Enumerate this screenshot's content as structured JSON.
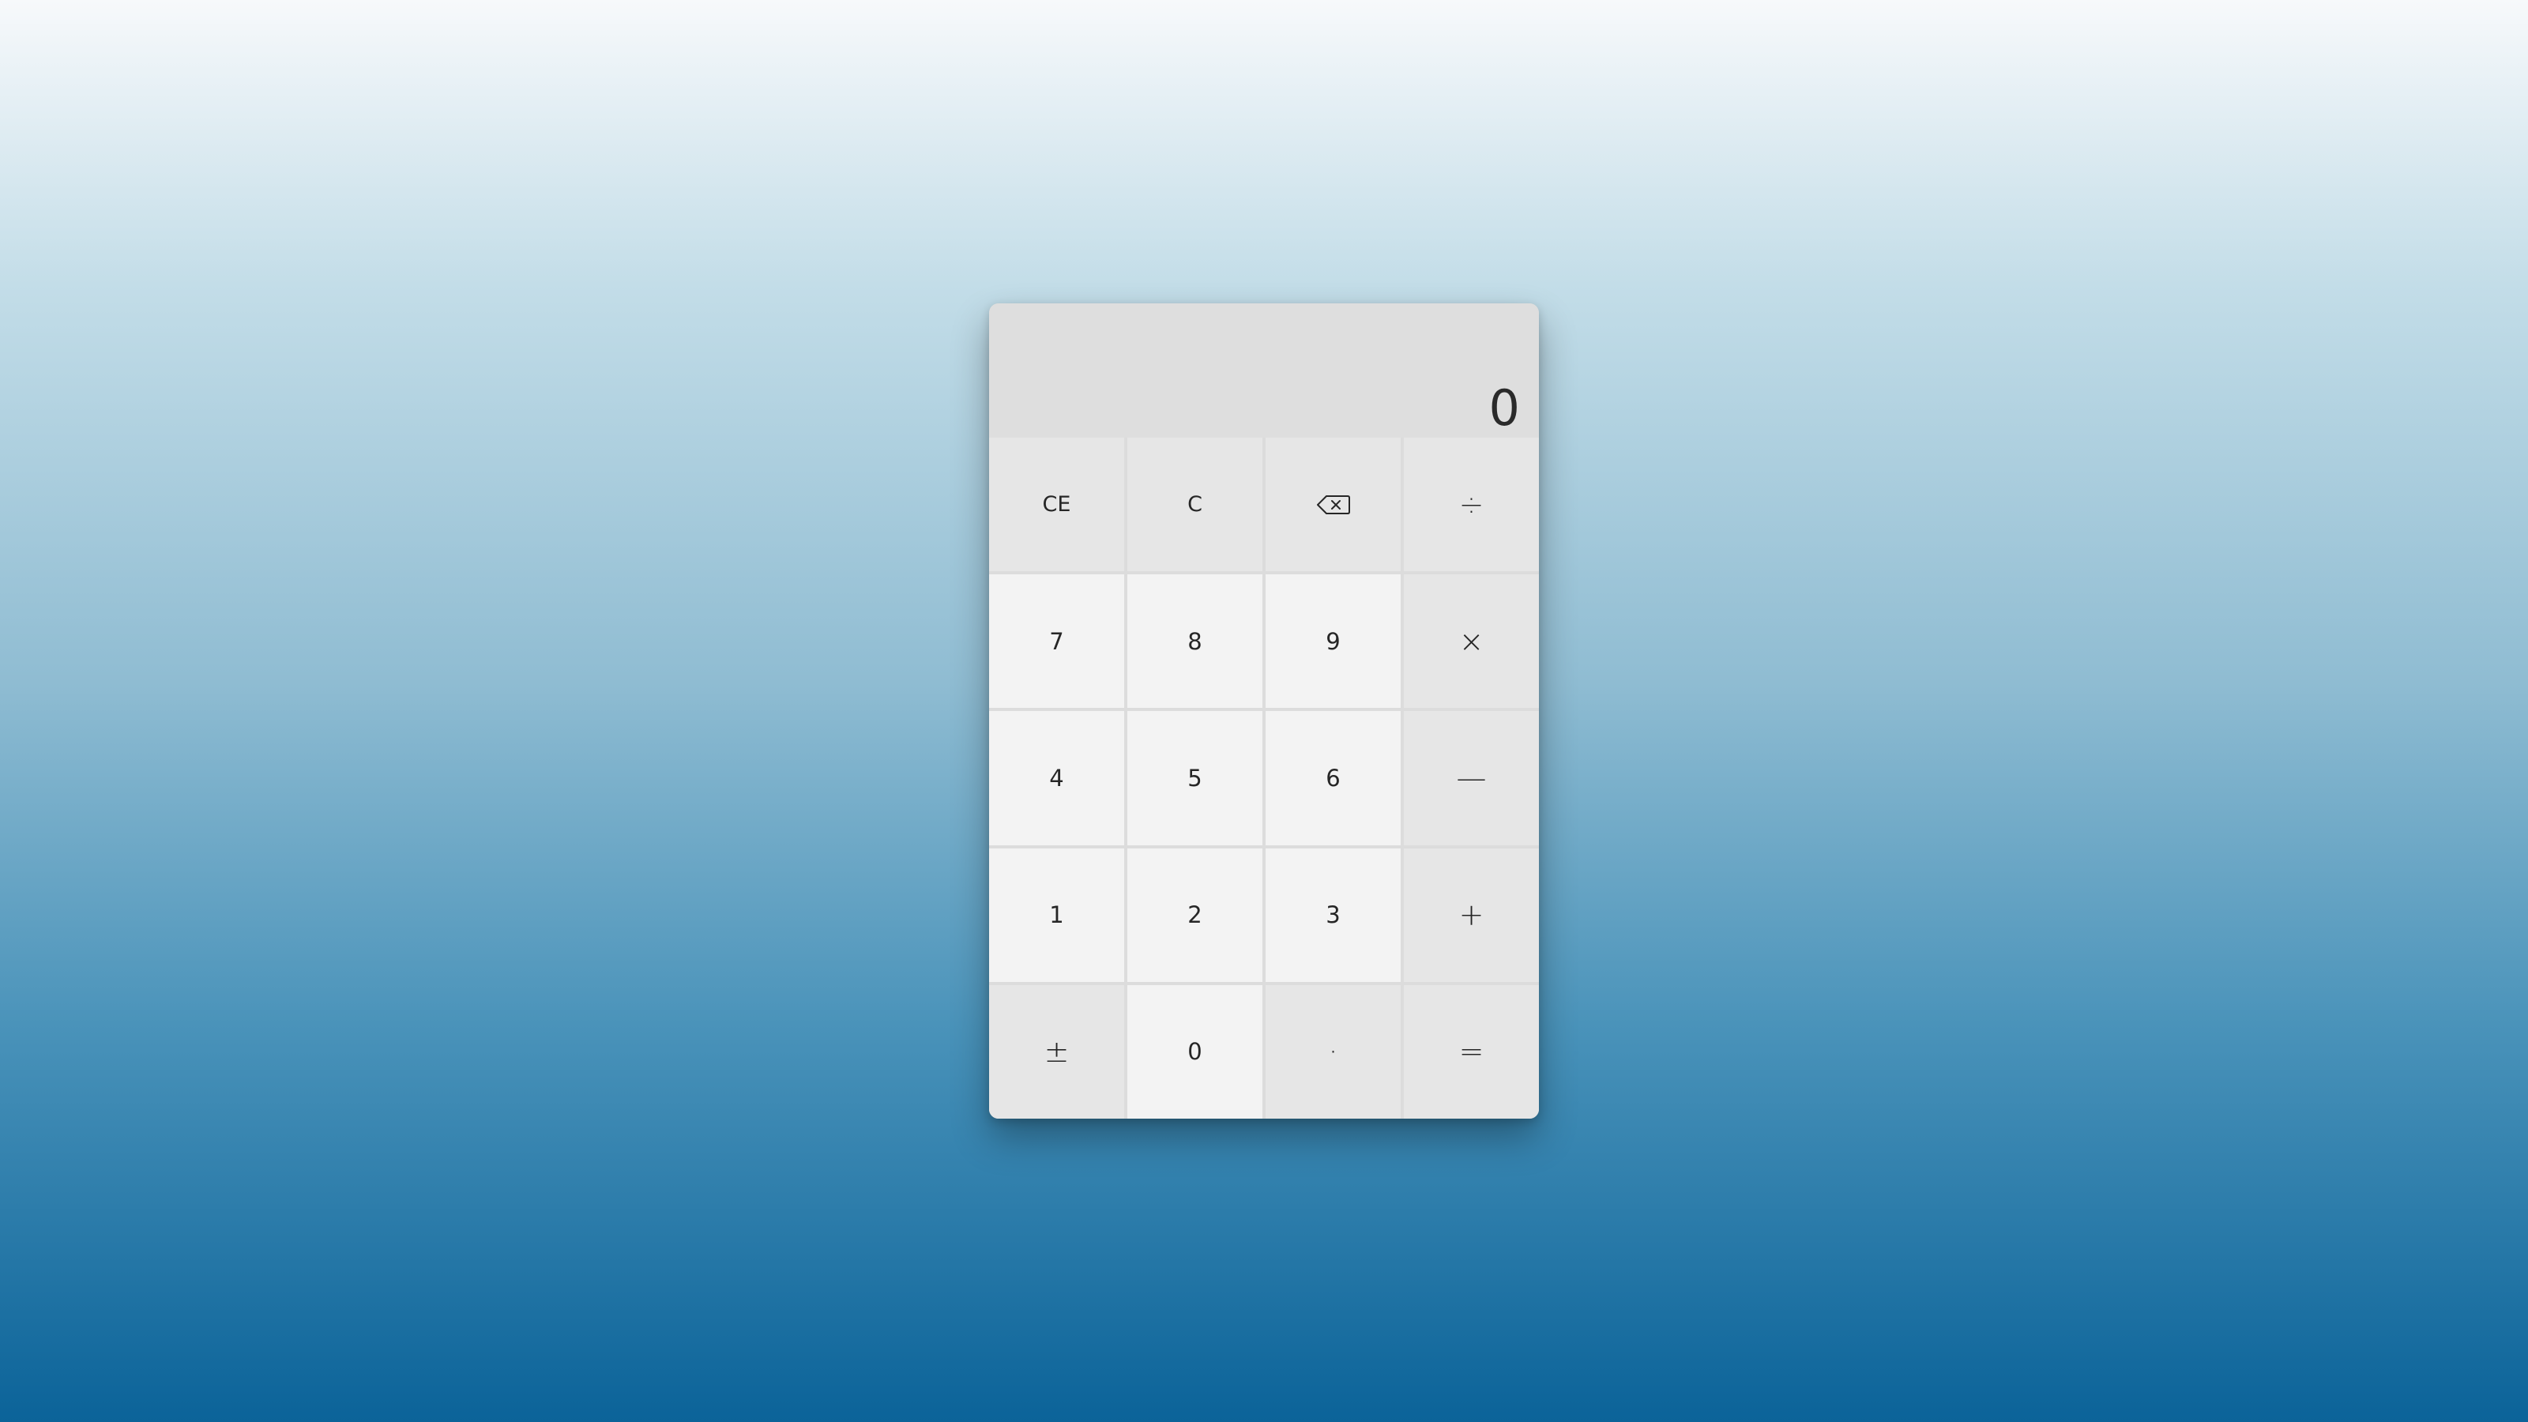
{
  "display": {
    "value": "0"
  },
  "keys": {
    "ce": "CE",
    "c": "C",
    "backspace_icon": "backspace-icon",
    "divide": "÷",
    "seven": "7",
    "eight": "8",
    "nine": "9",
    "multiply": "×",
    "four": "4",
    "five": "5",
    "six": "6",
    "minus": "—",
    "one": "1",
    "two": "2",
    "three": "3",
    "plus": "+",
    "negate": "±",
    "zero": "0",
    "decimal": "·",
    "equals": "="
  },
  "colors": {
    "display_bg": "#dedede",
    "number_key_bg": "#f3f3f3",
    "function_key_bg": "#e6e6e6",
    "text": "#262626"
  }
}
